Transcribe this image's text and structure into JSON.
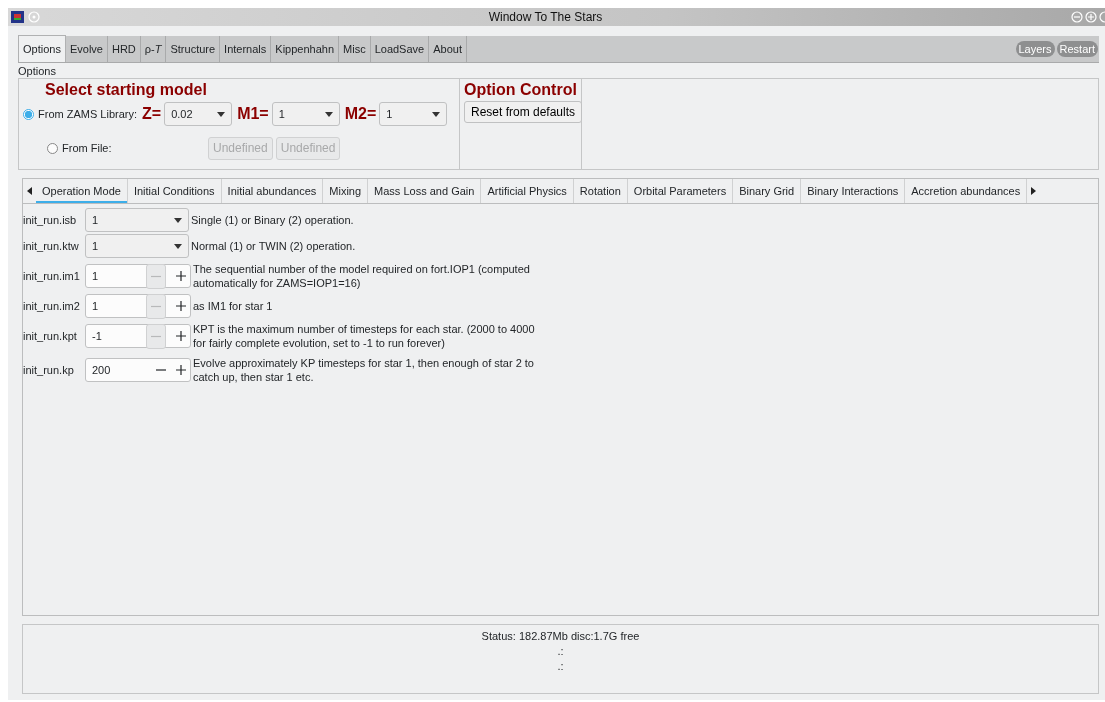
{
  "window": {
    "title": "Window To The Stars"
  },
  "tabs": [
    {
      "label": "Options",
      "selected": true
    },
    {
      "label": "Evolve",
      "selected": false
    },
    {
      "label": "HRD",
      "selected": false
    },
    {
      "label": "ρ-*T*",
      "selected": false
    },
    {
      "label": "Structure",
      "selected": false
    },
    {
      "label": "Internals",
      "selected": false
    },
    {
      "label": "Kippenhahn",
      "selected": false
    },
    {
      "label": "Misc",
      "selected": false
    },
    {
      "label": "LoadSave",
      "selected": false
    },
    {
      "label": "About",
      "selected": false
    }
  ],
  "corner_buttons": [
    "Layers",
    "Restart"
  ],
  "group_title": "Options",
  "starting_model": {
    "heading": "Select starting model",
    "sources": [
      {
        "label": "From ZAMS Library:",
        "selected": true
      },
      {
        "label": "From File:",
        "selected": false
      }
    ],
    "selectors": [
      {
        "label": "Z=",
        "value": "0.02"
      },
      {
        "label": "M1=",
        "value": "1"
      },
      {
        "label": "M2=",
        "value": "1"
      }
    ],
    "file_buttons": [
      "Undefined",
      "Undefined"
    ]
  },
  "option_control": {
    "heading": "Option Control",
    "button": "Reset from defaults"
  },
  "subtabs": [
    {
      "label": "Operation Mode",
      "selected": true
    },
    {
      "label": "Initial Conditions",
      "selected": false
    },
    {
      "label": "Initial abundances",
      "selected": false
    },
    {
      "label": "Mixing",
      "selected": false
    },
    {
      "label": "Mass Loss and Gain",
      "selected": false
    },
    {
      "label": "Artificial Physics",
      "selected": false
    },
    {
      "label": "Rotation",
      "selected": false
    },
    {
      "label": "Orbital Parameters",
      "selected": false
    },
    {
      "label": "Binary Grid",
      "selected": false
    },
    {
      "label": "Binary Interactions",
      "selected": false
    },
    {
      "label": "Accretion abundances",
      "selected": false
    }
  ],
  "params": [
    {
      "kind": "dropdown",
      "name": "init_run.isb",
      "value": "1",
      "description": "Single (1) or Binary (2) operation."
    },
    {
      "kind": "dropdown",
      "name": "init_run.ktw",
      "value": "1",
      "description": "Normal (1) or TWIN (2) operation."
    },
    {
      "kind": "spinner",
      "name": "init_run.im1",
      "value": "1",
      "minus_disabled": true,
      "description": "The sequential number of the model required on fort.IOP1 (computed automatically for ZAMS=IOP1=16)"
    },
    {
      "kind": "spinner",
      "name": "init_run.im2",
      "value": "1",
      "minus_disabled": true,
      "description": "as IM1 for star 1"
    },
    {
      "kind": "spinner",
      "name": "init_run.kpt",
      "value": "-1",
      "minus_disabled": true,
      "description": "KPT is the maximum number of timesteps for each star. (2000 to 4000 for fairly complete evolution, set to -1 to run forever)"
    },
    {
      "kind": "spinner",
      "name": "init_run.kp",
      "value": "200",
      "minus_disabled": false,
      "description": "Evolve approximately KP timesteps for star 1, then enough of star 2 to catch up, then star 1 etc."
    }
  ],
  "status": {
    "text": "Status:  182.87Mb disc:1.7G free",
    "lines": [
      ".:",
      ".:"
    ]
  }
}
